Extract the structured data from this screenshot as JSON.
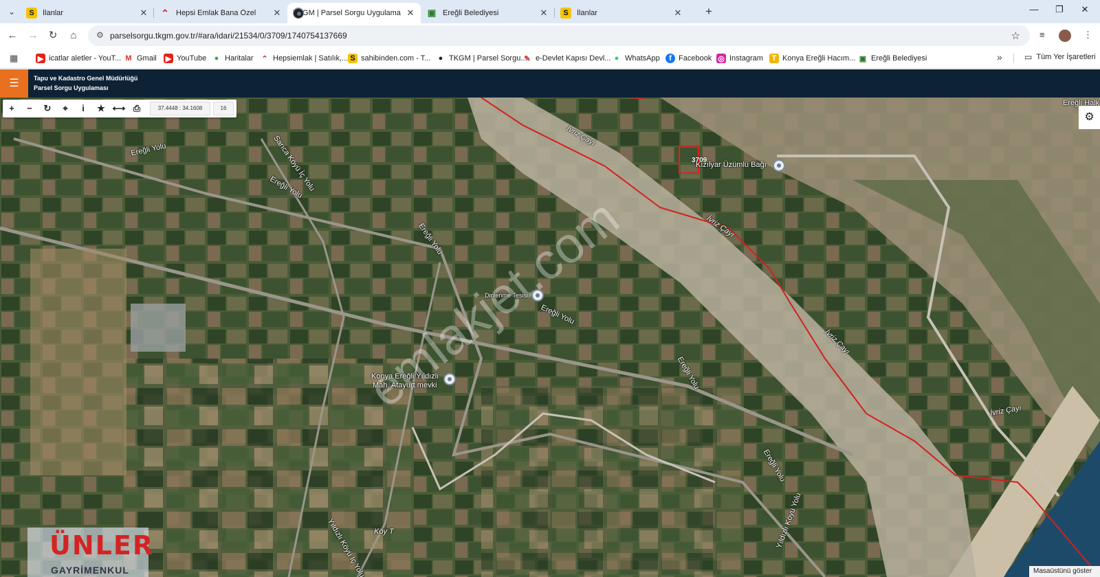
{
  "browser": {
    "tabs": [
      {
        "label": "İlanlar",
        "icon": "S",
        "active": false
      },
      {
        "label": "Hepsi Emlak Bana Özel",
        "icon": "hepsiemlak-icon",
        "active": false
      },
      {
        "label": "TKGM | Parsel Sorgu Uygulama",
        "icon": "map-pin-icon",
        "active": true
      },
      {
        "label": "Ereğli Belediyesi",
        "icon": "municipality-icon",
        "active": false
      },
      {
        "label": "İlanlar",
        "icon": "S",
        "active": false
      }
    ],
    "url": "parselsorgu.tkgm.gov.tr/#ara/idari/21534/0/3709/1740754137669",
    "bookmarks": [
      {
        "label": "icatlar aletler - YouT...",
        "icon": "youtube-icon"
      },
      {
        "label": "Gmail",
        "icon": "gmail-icon"
      },
      {
        "label": "YouTube",
        "icon": "youtube-icon"
      },
      {
        "label": "Haritalar",
        "icon": "maps-icon"
      },
      {
        "label": "Hepsiemlak | Satılık,...",
        "icon": "hepsiemlak-icon"
      },
      {
        "label": "sahibinden.com - T...",
        "icon": "S"
      },
      {
        "label": "TKGM | Parsel Sorgu...",
        "icon": "map-pin-icon"
      },
      {
        "label": "e-Devlet Kapısı Devl...",
        "icon": "edevlet-icon"
      },
      {
        "label": "WhatsApp",
        "icon": "whatsapp-icon"
      },
      {
        "label": "Facebook",
        "icon": "facebook-icon"
      },
      {
        "label": "Instagram",
        "icon": "instagram-icon"
      },
      {
        "label": "Konya Ereğli Hacım...",
        "icon": "t-icon"
      },
      {
        "label": "Ereğli Belediyesi",
        "icon": "municipality-icon"
      }
    ],
    "all_bookmarks": "Tüm Yer İşaretleri"
  },
  "app": {
    "title_line1": "Tapu ve Kadastro Genel Müdürlüğü",
    "title_line2": "Parsel Sorgu Uygulaması",
    "coords": "37.4448 : 34.1608",
    "zoom": "16"
  },
  "map": {
    "parcel_number": "3709",
    "pois": [
      "Kızılyar Üzümlü Bağı",
      "Dinlenme Tesisi",
      "Konya Ereğli Yıldızlı",
      "Mah. Atayurt mevki",
      "Ereğli Halk"
    ],
    "roads": [
      "Ereğli Yolu",
      "Ereğli Yolu",
      "Ereğli Yolu",
      "Ereğli Yolu",
      "Ereğli Yolu",
      "Ereğli Yolu",
      "Sarıca Köyü İç Yolu",
      "Yıldızlı Köyü Yolu",
      "Yıldızlı Köyü İç Yolu",
      "Köy T"
    ],
    "rivers": [
      "İvriz Çayı",
      "İvriz Çayı",
      "İvriz Çayı",
      "İvriz Çayı"
    ],
    "watermark": "emlakjet.com",
    "logo_line1": "ÜNLER",
    "logo_line2": "GAYRİMENKUL",
    "show_desktop": "Masaüstünü göster"
  },
  "colors": {
    "appbar": "#0e2236",
    "menu_button": "#e8701e",
    "boundary": "#d42020"
  }
}
